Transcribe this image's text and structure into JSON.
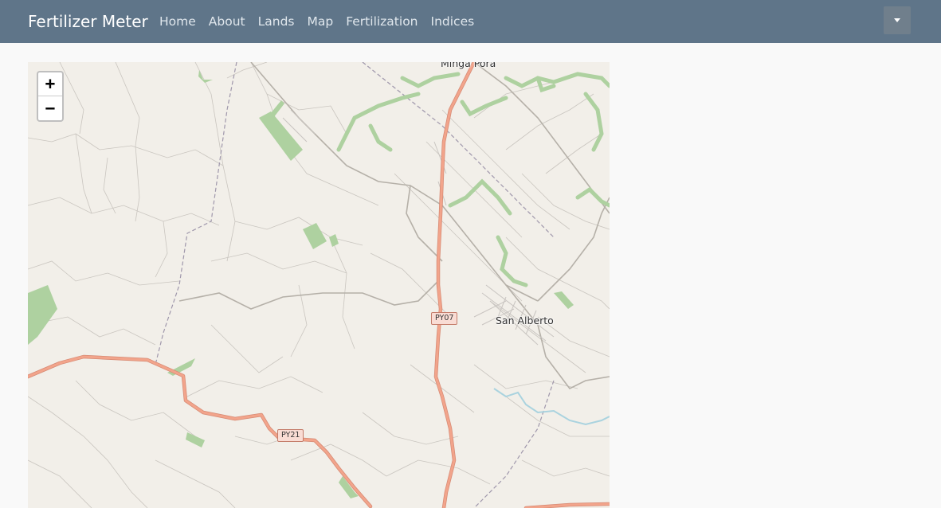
{
  "navbar": {
    "brand": "Fertilizer Meter",
    "links": [
      {
        "label": "Home"
      },
      {
        "label": "About"
      },
      {
        "label": "Lands"
      },
      {
        "label": "Map"
      },
      {
        "label": "Fertilization"
      },
      {
        "label": "Indices"
      }
    ],
    "dropdown_icon": "caret-down-icon",
    "background": "#5f7589"
  },
  "map": {
    "zoom_in": "+",
    "zoom_out": "−",
    "places": {
      "minga_pora": "Minga Porã",
      "san_alberto": "San Alberto"
    },
    "road_shields": {
      "py07": "PY07",
      "py21": "PY21"
    },
    "colors": {
      "land": "#f2efe9",
      "primary_road": "#f2a48b",
      "vegetation": "#aed1a0",
      "water": "#aad3df"
    }
  }
}
